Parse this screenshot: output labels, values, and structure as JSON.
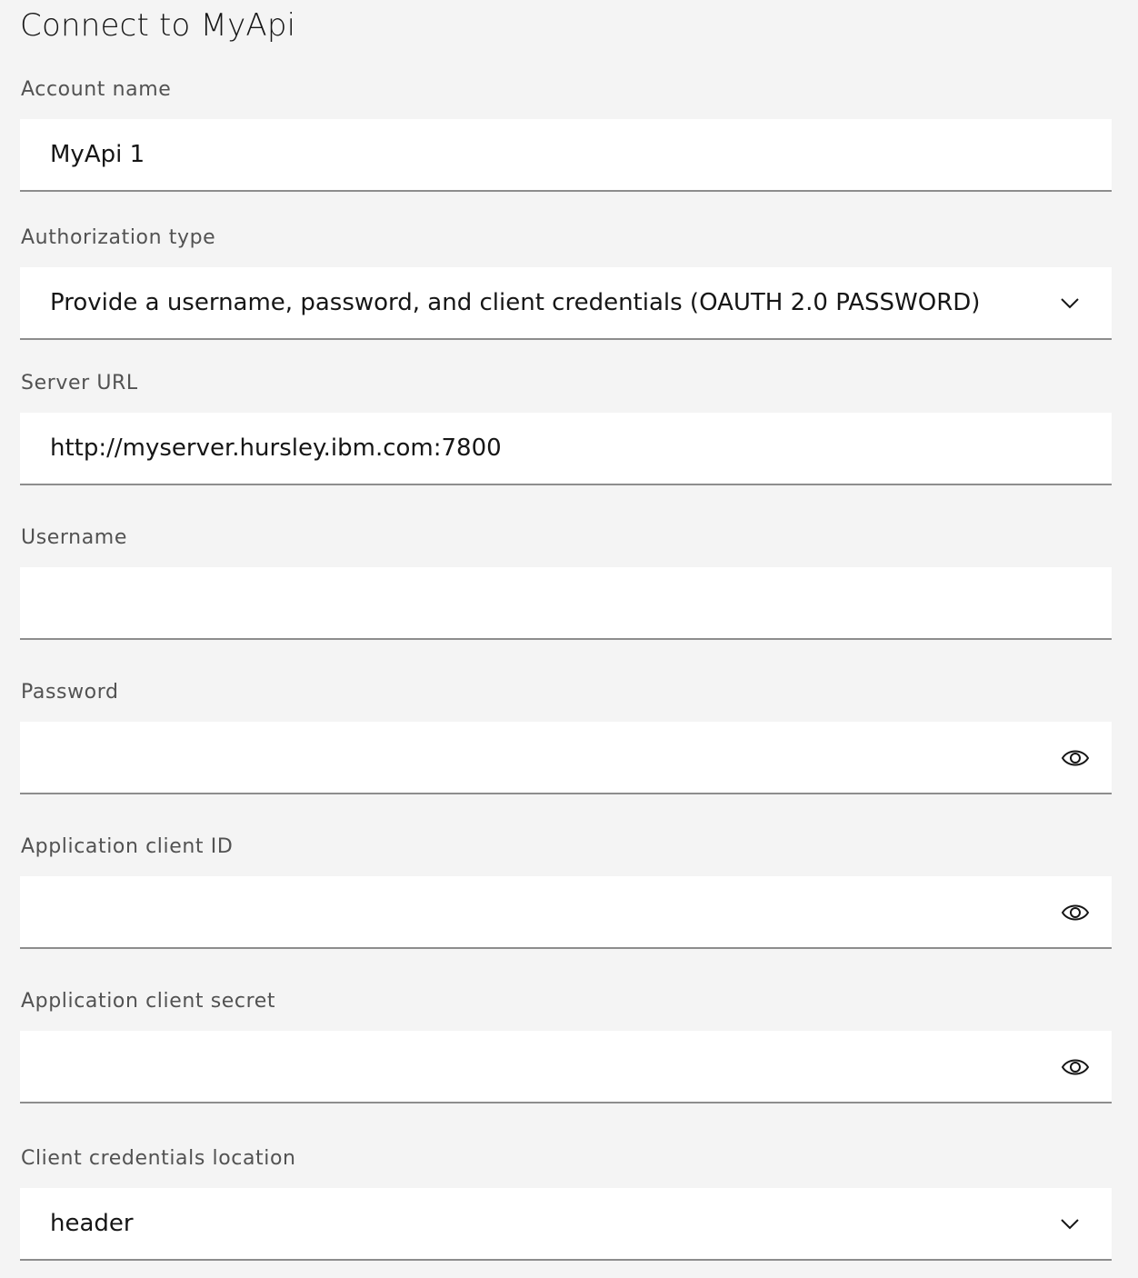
{
  "form": {
    "title": "Connect to MyApi",
    "account_name": {
      "label": "Account name",
      "value": "MyApi 1"
    },
    "authorization_type": {
      "label": "Authorization type",
      "selected": "Provide a username, password, and client credentials (OAUTH 2.0 PASSWORD)"
    },
    "server_url": {
      "label": "Server URL",
      "value": "http://myserver.hursley.ibm.com:7800"
    },
    "username": {
      "label": "Username",
      "value": ""
    },
    "password": {
      "label": "Password",
      "value": "",
      "icon": "eye-icon"
    },
    "client_id": {
      "label": "Application client ID",
      "value": "",
      "icon": "eye-icon"
    },
    "client_secret": {
      "label": "Application client secret",
      "value": "",
      "icon": "eye-icon"
    },
    "credentials_location": {
      "label": "Client credentials location",
      "selected": "header"
    }
  },
  "colors": {
    "background": "#f4f4f4",
    "field_background": "#ffffff",
    "field_border": "#8d8d8d",
    "label": "#525252",
    "text": "#161616"
  }
}
